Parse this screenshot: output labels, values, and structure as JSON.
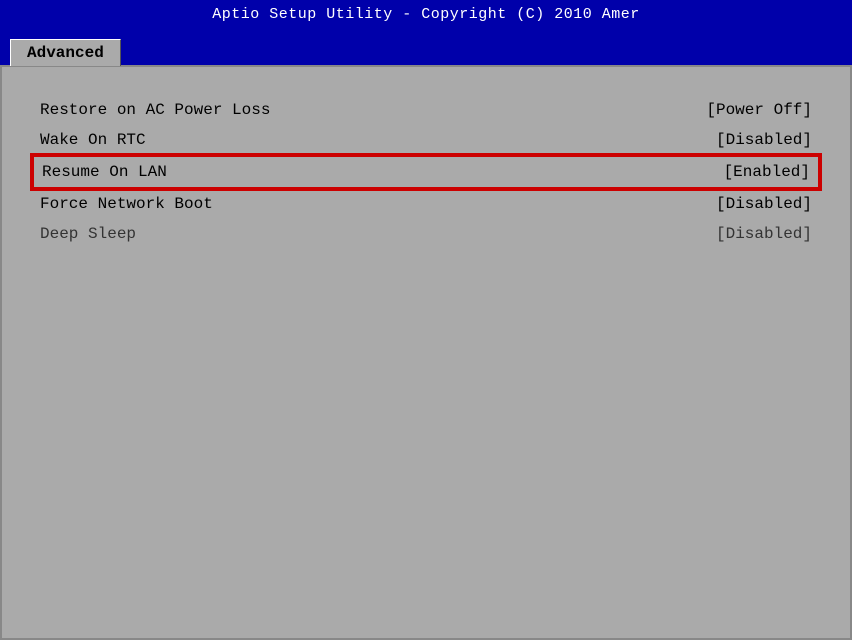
{
  "title_bar": {
    "text": "Aptio Setup Utility - Copyright (C) 2010 Amer"
  },
  "tabs": [
    {
      "label": "Advanced",
      "active": true
    }
  ],
  "menu_items": [
    {
      "id": "restore-ac",
      "label": "Restore on AC Power Loss",
      "value": "[Power Off]",
      "selected": false,
      "dim": false
    },
    {
      "id": "wake-rtc",
      "label": "Wake On RTC",
      "value": "[Disabled]",
      "selected": false,
      "dim": false
    },
    {
      "id": "resume-lan",
      "label": "Resume On LAN",
      "value": "[Enabled]",
      "selected": true,
      "dim": false
    },
    {
      "id": "force-network-boot",
      "label": "Force Network Boot",
      "value": "[Disabled]",
      "selected": false,
      "dim": false
    },
    {
      "id": "deep-sleep",
      "label": "Deep Sleep",
      "value": "[Disabled]",
      "selected": false,
      "dim": true
    }
  ]
}
